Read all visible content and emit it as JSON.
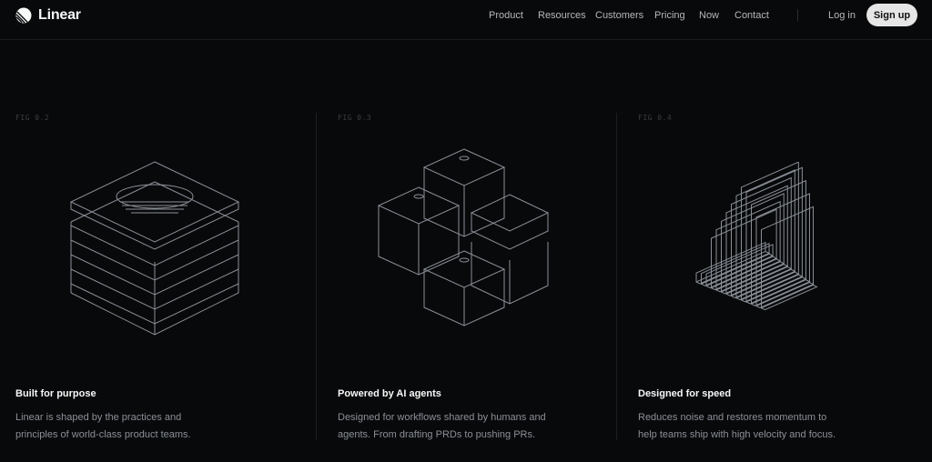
{
  "brand": {
    "name": "Linear",
    "logo_icon": "linear-logo-icon"
  },
  "nav": {
    "items": [
      {
        "label": "Product"
      },
      {
        "label": "Resources"
      },
      {
        "label": "Customers"
      },
      {
        "label": "Pricing"
      },
      {
        "label": "Now"
      },
      {
        "label": "Contact"
      }
    ],
    "login_label": "Log in",
    "signup_label": "Sign up"
  },
  "cards": [
    {
      "fig": "FIG 0.2",
      "title": "Built for purpose",
      "desc_line1": "Linear is shaped by the practices and",
      "desc_line2": "principles of world-class product teams."
    },
    {
      "fig": "FIG 0.3",
      "title": "Powered by AI agents",
      "desc_line1": "Designed for workflows shared by humans and",
      "desc_line2": "agents. From drafting PRDs to pushing PRs."
    },
    {
      "fig": "FIG 0.4",
      "title": "Designed for speed",
      "desc_line1": "Reduces noise and restores momentum to",
      "desc_line2": "help teams ship with high velocity and focus."
    }
  ],
  "colors": {
    "background": "#08090a",
    "text": "#f7f8f8",
    "muted": "#8a8f98",
    "button_bg": "#e6e6e6"
  }
}
